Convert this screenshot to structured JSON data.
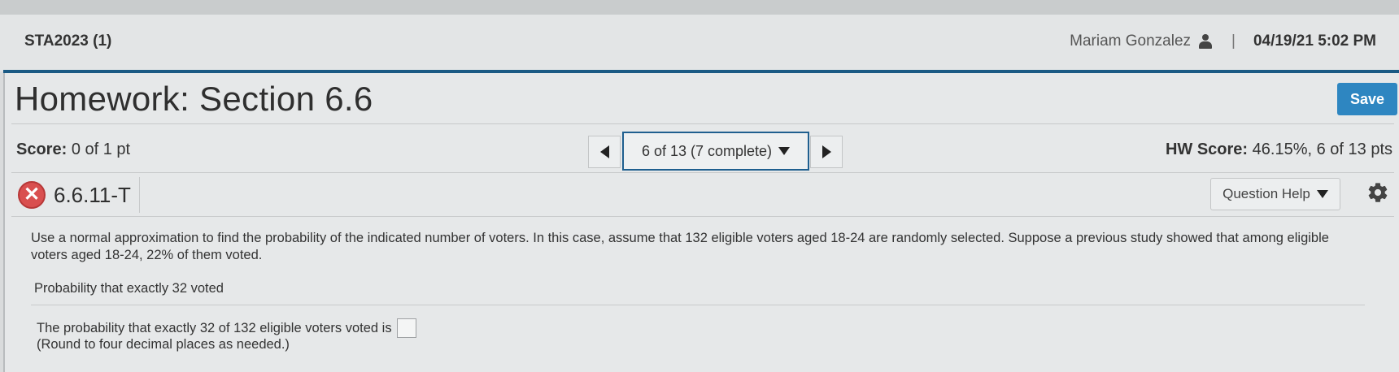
{
  "header": {
    "course": "STA2023 (1)",
    "user_name": "Mariam Gonzalez",
    "separator": "|",
    "datetime": "04/19/21 5:02 PM"
  },
  "homework": {
    "title": "Homework: Section 6.6",
    "save_label": "Save"
  },
  "score_row": {
    "score_label": "Score:",
    "score_value": "0 of 1 pt",
    "nav_selector": "6 of 13 (7 complete)",
    "hw_score_label": "HW Score:",
    "hw_score_value": "46.15%, 6 of 13 pts"
  },
  "question": {
    "status_icon": "x-mark-icon",
    "id": "6.6.11-T",
    "help_label": "Question Help",
    "text": "Use a normal approximation to find the probability of the indicated number of voters. In this case, assume that 132 eligible voters aged 18-24 are randomly selected. Suppose a previous study showed that among eligible voters aged 18-24, 22% of them voted.",
    "sub_label": "Probability that exactly 32 voted",
    "answer_prompt": "The probability that exactly 32 of 132 eligible voters voted is",
    "round_note": "(Round to four decimal places as needed.)"
  },
  "colors": {
    "accent_blue": "#1a5a84",
    "save_button": "#2e86c1",
    "incorrect_red": "#d94f4f"
  }
}
